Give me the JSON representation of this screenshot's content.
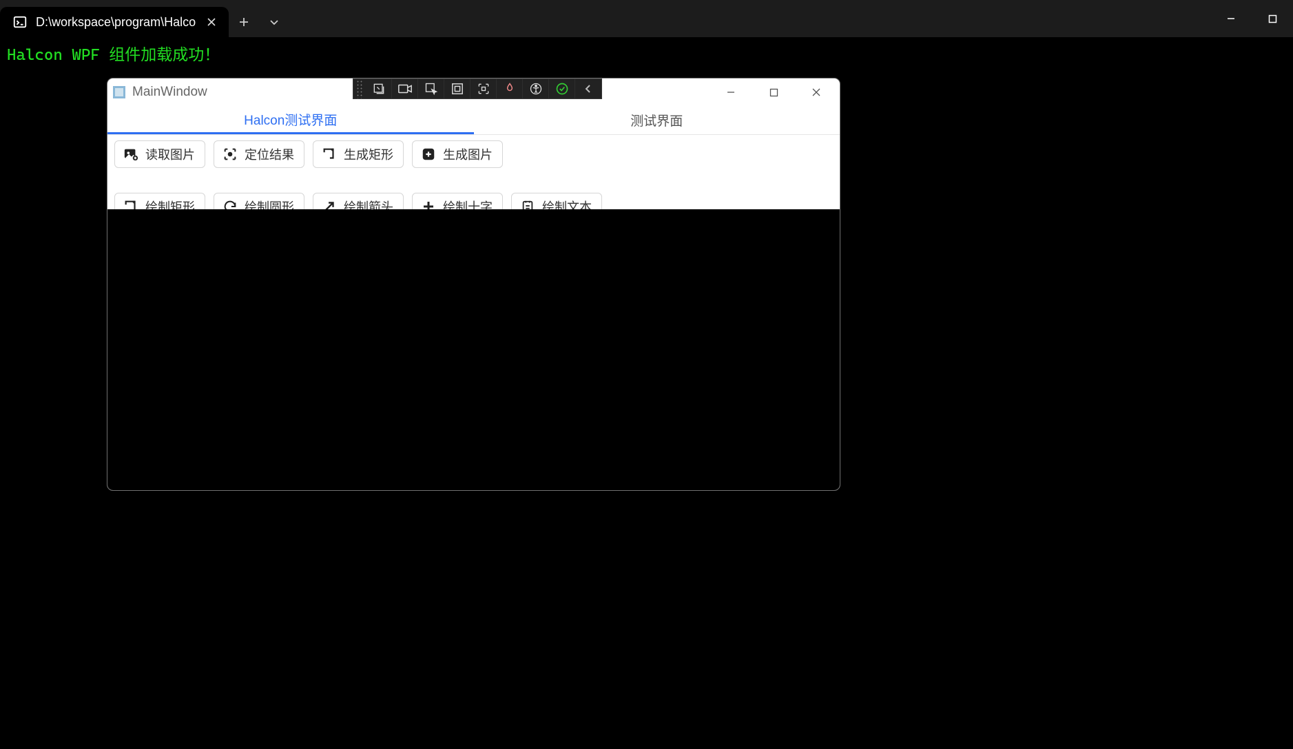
{
  "terminal": {
    "tab_title": "D:\\workspace\\program\\Halco",
    "console_output": "Halcon WPF 组件加载成功！"
  },
  "app": {
    "title": "MainWindow",
    "tabs": [
      {
        "label": "Halcon测试界面",
        "active": true
      },
      {
        "label": "测试界面",
        "active": false
      }
    ],
    "toolbar": {
      "row1": [
        {
          "id": "read-image",
          "label": "读取图片",
          "icon": "image-add"
        },
        {
          "id": "locate-result",
          "label": "定位结果",
          "icon": "crosshair"
        },
        {
          "id": "gen-rect",
          "label": "生成矩形",
          "icon": "rect-add"
        },
        {
          "id": "gen-image",
          "label": "生成图片",
          "icon": "plus-box"
        }
      ],
      "row2": [
        {
          "id": "draw-rect",
          "label": "绘制矩形",
          "icon": "rect-add"
        },
        {
          "id": "draw-circle",
          "label": "绘制圆形",
          "icon": "refresh"
        },
        {
          "id": "draw-arrow",
          "label": "绘制箭头",
          "icon": "arrow-diag"
        },
        {
          "id": "draw-cross",
          "label": "绘制十字",
          "icon": "plus"
        },
        {
          "id": "draw-text",
          "label": "绘制文本",
          "icon": "text-doc"
        }
      ]
    }
  },
  "colors": {
    "tab_active": "#2e6ff2",
    "console_green": "#22dd22"
  }
}
